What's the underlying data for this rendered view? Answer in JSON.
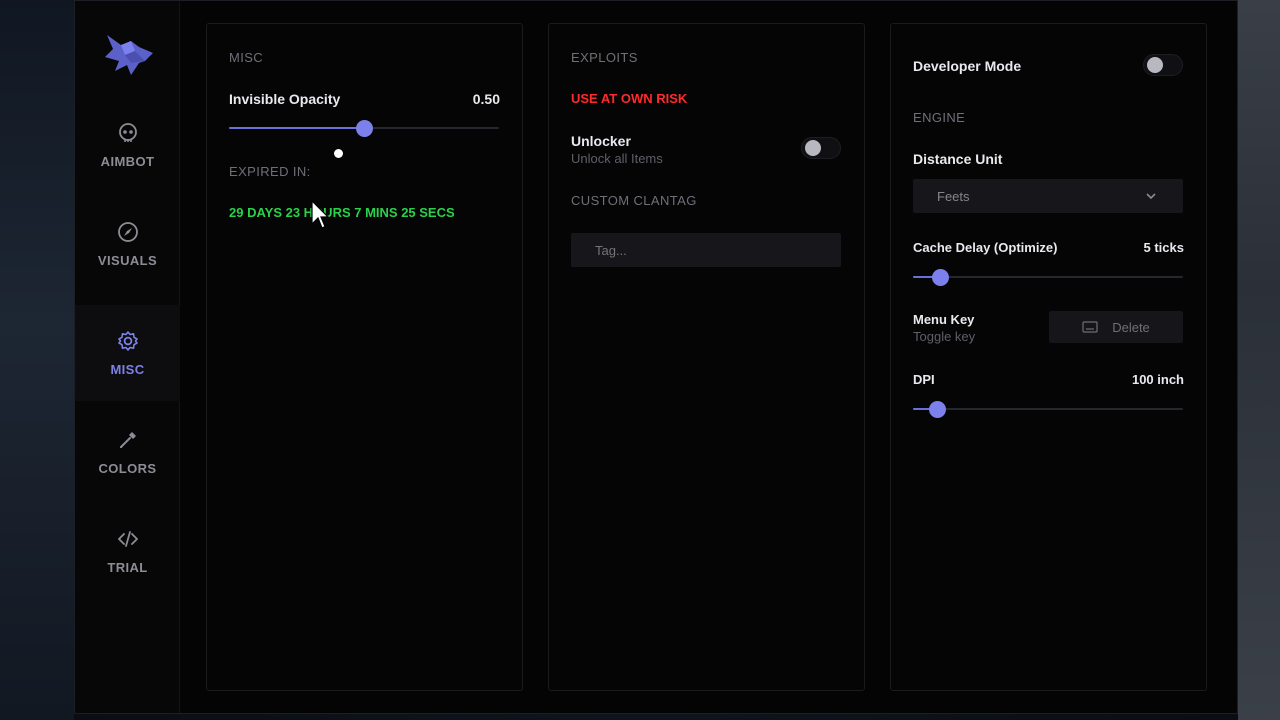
{
  "sidebar": {
    "items": [
      {
        "label": "AIMBOT",
        "icon": "skull-icon"
      },
      {
        "label": "VISUALS",
        "icon": "compass-icon"
      },
      {
        "label": "MISC",
        "icon": "gear-icon"
      },
      {
        "label": "COLORS",
        "icon": "eyedropper-icon"
      },
      {
        "label": "TRIAL",
        "icon": "code-icon"
      }
    ],
    "active": "MISC"
  },
  "misc": {
    "section_title": "MISC",
    "opacity_label": "Invisible Opacity",
    "opacity_value": "0.50",
    "opacity_fraction": 0.5,
    "expired_title": "EXPIRED IN:",
    "expired_value": "29 DAYS 23 HOURS 7 MINS 25 SECS",
    "expired_color": "#2bd14a"
  },
  "exploits": {
    "section_title": "EXPLOITS",
    "warning": "USE AT OWN RISK",
    "warning_color": "#ff2a2a",
    "unlocker_label": "Unlocker",
    "unlocker_sub": "Unlock all Items",
    "unlocker_on": false,
    "clantag_title": "CUSTOM CLANTAG",
    "clantag_placeholder": "Tag..."
  },
  "settings": {
    "developer_mode_label": "Developer Mode",
    "developer_mode_on": false,
    "engine_title": "ENGINE",
    "distance_unit_label": "Distance Unit",
    "distance_unit_value": "Feets",
    "cache_delay_label": "Cache Delay (Optimize)",
    "cache_delay_value": "5 ticks",
    "cache_delay_fraction": 0.1,
    "menu_key_label": "Menu Key",
    "menu_key_sub": "Toggle key",
    "menu_key_button": "Delete",
    "dpi_label": "DPI",
    "dpi_value": "100 inch",
    "dpi_fraction": 0.09
  },
  "accent_color": "#7b80ec"
}
